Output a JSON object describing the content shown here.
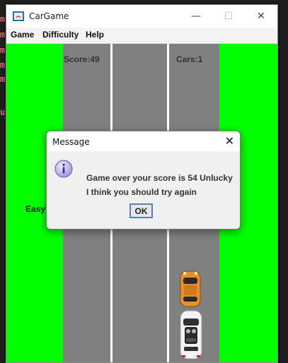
{
  "window": {
    "title": "CarGame",
    "minimize": "—",
    "maximize": "☐",
    "close": "✕"
  },
  "menu": [
    "Game",
    "Difficulty",
    "Help"
  ],
  "game": {
    "score": "Score:49",
    "cars": "Cars:1",
    "difficulty": "Easy",
    "colors": {
      "grass": "#00ff00",
      "road": "#808080",
      "lane": "#ffffff"
    }
  },
  "dialog": {
    "title": "Message",
    "close": "✕",
    "icon": "info-icon",
    "line1": "Game over your score is 54 Unlucky",
    "line2": "I think you should try again",
    "ok": "OK"
  }
}
